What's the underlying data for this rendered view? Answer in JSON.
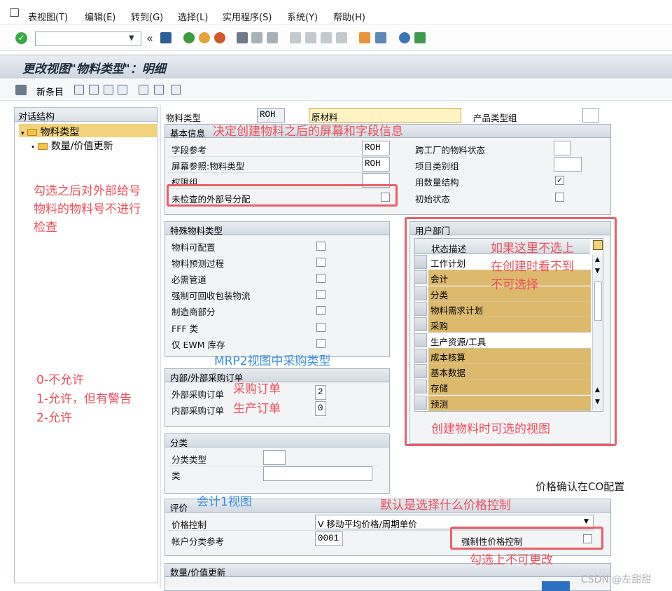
{
  "menubar": {
    "items": [
      "表视图(T)",
      "编辑(E)",
      "转到(G)",
      "选择(L)",
      "实用程序(S)",
      "系统(Y)",
      "帮助(H)"
    ]
  },
  "toolbar": {
    "nav_prev": "«"
  },
  "page_title": "更改视图\"物料类型\"：明细",
  "app_toolbar": {
    "new_entries": "新条目"
  },
  "tree": {
    "header": "对话结构",
    "items": [
      "物料类型",
      "数量/价值更新"
    ]
  },
  "header_fields": {
    "material_type_label": "物料类型",
    "material_type_value": "ROH",
    "material_type_desc": "原材料",
    "product_type_group_label": "产品类型组"
  },
  "basic_info": {
    "title": "基本信息",
    "field_ref_label": "字段参考",
    "field_ref_value": "ROH",
    "screen_ref_label": "屏幕参照:物料类型",
    "screen_ref_value": "ROH",
    "auth_group_label": "权限组",
    "ext_no_check_label": "未检查的外部号分配",
    "cross_plant_status_label": "跨工厂的物料状态",
    "item_category_group_label": "项目类别组",
    "qty_structure_label": "用数量结构",
    "qty_structure_checked": "✓",
    "initial_status_label": "初始状态"
  },
  "special_types": {
    "title": "特殊物料类型",
    "items": [
      "物料可配置",
      "物料预测过程",
      "必需管道",
      "强制可回收包装物流",
      "制造商部分",
      "FFF 类",
      "仅 EWM 库存"
    ]
  },
  "procurement": {
    "title": "内部/外部采购订单",
    "external_label": "外部采购订单",
    "external_value": "2",
    "internal_label": "内部采购订单",
    "internal_value": "0"
  },
  "classification": {
    "title": "分类",
    "class_type_label": "分类类型",
    "class_label": "类"
  },
  "valuation": {
    "title": "评价",
    "price_control_label": "价格控制",
    "price_control_value": "V 移动平均价格/周期单价",
    "acct_cat_ref_label": "帐户分类参考",
    "acct_cat_ref_value": "0001",
    "forced_price_control_label": "强制性价格控制"
  },
  "qty_value_update": {
    "title": "数量/价值更新"
  },
  "user_dept": {
    "title": "用户部门",
    "column": "状态描述",
    "rows": [
      {
        "label": "工作计划",
        "selected": false
      },
      {
        "label": "会计",
        "selected": true
      },
      {
        "label": "分类",
        "selected": true
      },
      {
        "label": "物料需求计划",
        "selected": true
      },
      {
        "label": "采购",
        "selected": true
      },
      {
        "label": "生产资源/工具",
        "selected": false
      },
      {
        "label": "成本核算",
        "selected": true
      },
      {
        "label": "基本数据",
        "selected": true
      },
      {
        "label": "存储",
        "selected": true
      },
      {
        "label": "预测",
        "selected": true
      }
    ]
  },
  "annotations": {
    "screen_field_info": "决定创建物料之后的屏幕和字段信息",
    "ext_check_1": "勾选之后对外部给号",
    "ext_check_2": "物料的物料号不进行",
    "ext_check_3": "检查",
    "mrp2": "MRP2视图中采购类型",
    "purchase_order": "采购订单",
    "production_order": "生产订单",
    "allow_0": "0-不允许",
    "allow_1": "1-允许，但有警告",
    "allow_2": "2-允许",
    "dept_note_1": "如果这里不选上",
    "dept_note_2": "在创建时看不到",
    "dept_note_3": "不可选择",
    "dept_views": "创建物料时可选的视图",
    "price_confirm": "价格确认在CO配置",
    "acct1": "会计1视图",
    "default_price": "默认是选择什么价格控制",
    "no_change": "勾选上不可更改"
  },
  "watermark": "CSDN @左甜甜",
  "colors": {
    "annotation_red": "#ec4f5a",
    "annotation_blue": "#3c8ee0",
    "selected_row": "#dcb96c"
  }
}
